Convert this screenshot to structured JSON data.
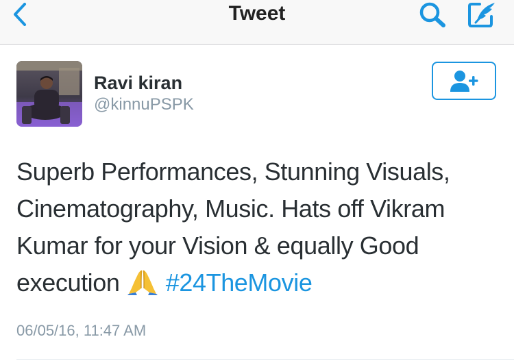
{
  "navbar": {
    "title": "Tweet",
    "icons": {
      "back": "chevron-left-icon",
      "search": "search-icon",
      "compose": "compose-tweet-icon"
    }
  },
  "author": {
    "display_name": "Ravi kiran",
    "handle": "@kinnuPSPK",
    "avatar": "profile-photo"
  },
  "follow_button": {
    "icon": "follow-user-icon"
  },
  "tweet": {
    "text_lines": [
      "Superb Performances, Stunning Visuals,",
      "Cinematography, Music. Hats off Vikram",
      "Kumar for your Vision & equally Good",
      "execution"
    ],
    "emoji": "folded-hands",
    "hashtag": "#24TheMovie",
    "timestamp": "06/05/16, 11:47 AM"
  },
  "colors": {
    "accent": "#1b95e0",
    "text": "#292f33",
    "secondary_text": "#8899a6",
    "navbar_bg": "#f8f8f8"
  }
}
